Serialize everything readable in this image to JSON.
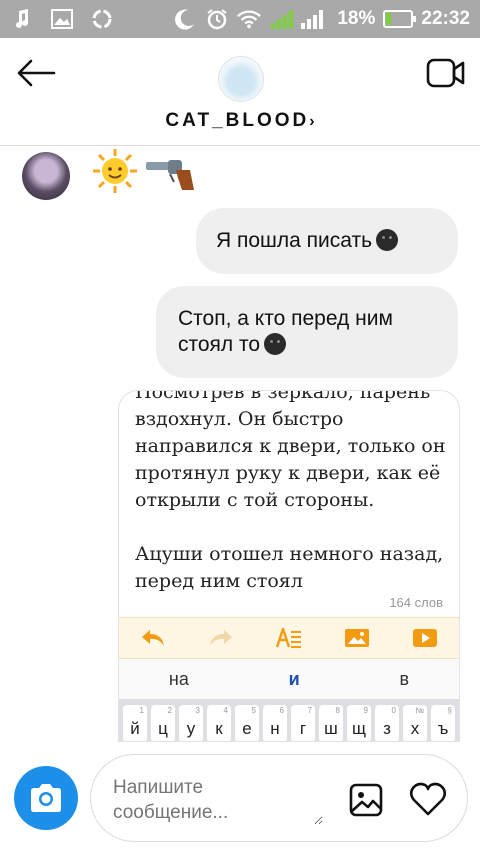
{
  "status_bar": {
    "battery_percent": "18%",
    "time": "22:32",
    "sim_1": "1",
    "sim_2": "2",
    "battery_level": 0.18,
    "icons": [
      "music-note-icon",
      "image-icon",
      "sync-icon",
      "moon-icon",
      "alarm-icon",
      "wifi-icon",
      "signal-icon",
      "battery-icon"
    ]
  },
  "header": {
    "username": "CAT_BLOOD",
    "chevron": "›",
    "icons": [
      "back-arrow-icon",
      "video-call-icon"
    ]
  },
  "messages": {
    "emoji_message": [
      "sun-emoji",
      "revolver-emoji"
    ],
    "sent_1": "Я пошла писать",
    "sent_2": "Стоп, а кто перед ним стоял то"
  },
  "screenshot_message": {
    "lines": [
      "Посмотрев в зеркало, парень",
      "вздохнул. Он быстро",
      "направился к двери, только он",
      "протянул руку к двери, как её",
      "открыли с той стороны.",
      "",
      "Ацуши отошел немного назад,",
      "перед ним стоял"
    ],
    "word_count": "164 слов",
    "suggestions": [
      "на",
      "и",
      "в"
    ],
    "keys": [
      "й",
      "ц",
      "у",
      "к",
      "е",
      "н",
      "г",
      "ш",
      "щ",
      "з",
      "х",
      "ъ"
    ],
    "key_numbers": [
      "1",
      "2",
      "3",
      "4",
      "5",
      "6",
      "7",
      "8",
      "9",
      "0",
      "№",
      "§"
    ],
    "accent_color": "#f39c12"
  },
  "composer": {
    "placeholder": "Напишите сообщение...",
    "camera_color": "#1e8fe8"
  }
}
